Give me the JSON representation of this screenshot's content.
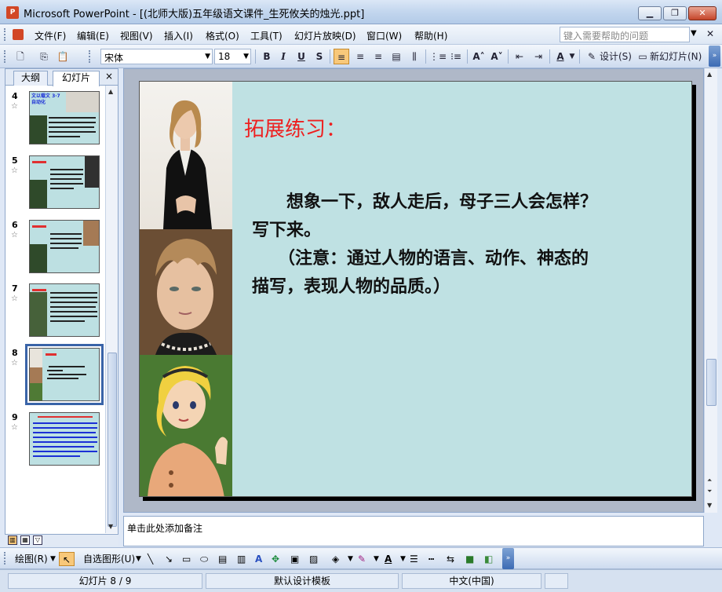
{
  "window": {
    "title": "Microsoft PowerPoint - [(北师大版)五年级语文课件_生死攸关的烛光.ppt]"
  },
  "menu": {
    "items": [
      "文件(F)",
      "编辑(E)",
      "视图(V)",
      "插入(I)",
      "格式(O)",
      "工具(T)",
      "幻灯片放映(D)",
      "窗口(W)",
      "帮助(H)"
    ],
    "help_placeholder": "键入需要帮助的问题"
  },
  "toolbar": {
    "font_name": "宋体",
    "font_size": "18",
    "bold": "B",
    "italic": "I",
    "underline": "U",
    "shadow": "S",
    "design_label": "设计(S)",
    "new_slide_label": "新幻灯片(N)"
  },
  "left_panel": {
    "tab_outline": "大纲",
    "tab_slides": "幻灯片",
    "close": "×",
    "slides": [
      {
        "number": "4"
      },
      {
        "number": "5"
      },
      {
        "number": "6"
      },
      {
        "number": "7"
      },
      {
        "number": "8"
      },
      {
        "number": "9"
      }
    ],
    "thumb4_title": "文以载文 3·7 自动化"
  },
  "slide": {
    "title": "拓展练习：",
    "body_line1": "　　想象一下，敌人走后，母子三人会怎样？写下来。",
    "body_line2": "　　（注意：通过人物的语言、动作、神态的描写，表现人物的品质。）"
  },
  "notes": {
    "placeholder": "单击此处添加备注"
  },
  "draw_toolbar": {
    "draw_label": "绘图(R)",
    "autoshapes_label": "自选图形(U)"
  },
  "status": {
    "slide_position": "幻灯片 8 / 9",
    "design": "默认设计模板",
    "language": "中文(中国)"
  },
  "colors": {
    "slide_background": "#bfe1e3",
    "title_red": "#ee1f1f",
    "selection_blue": "#3a64a8"
  }
}
